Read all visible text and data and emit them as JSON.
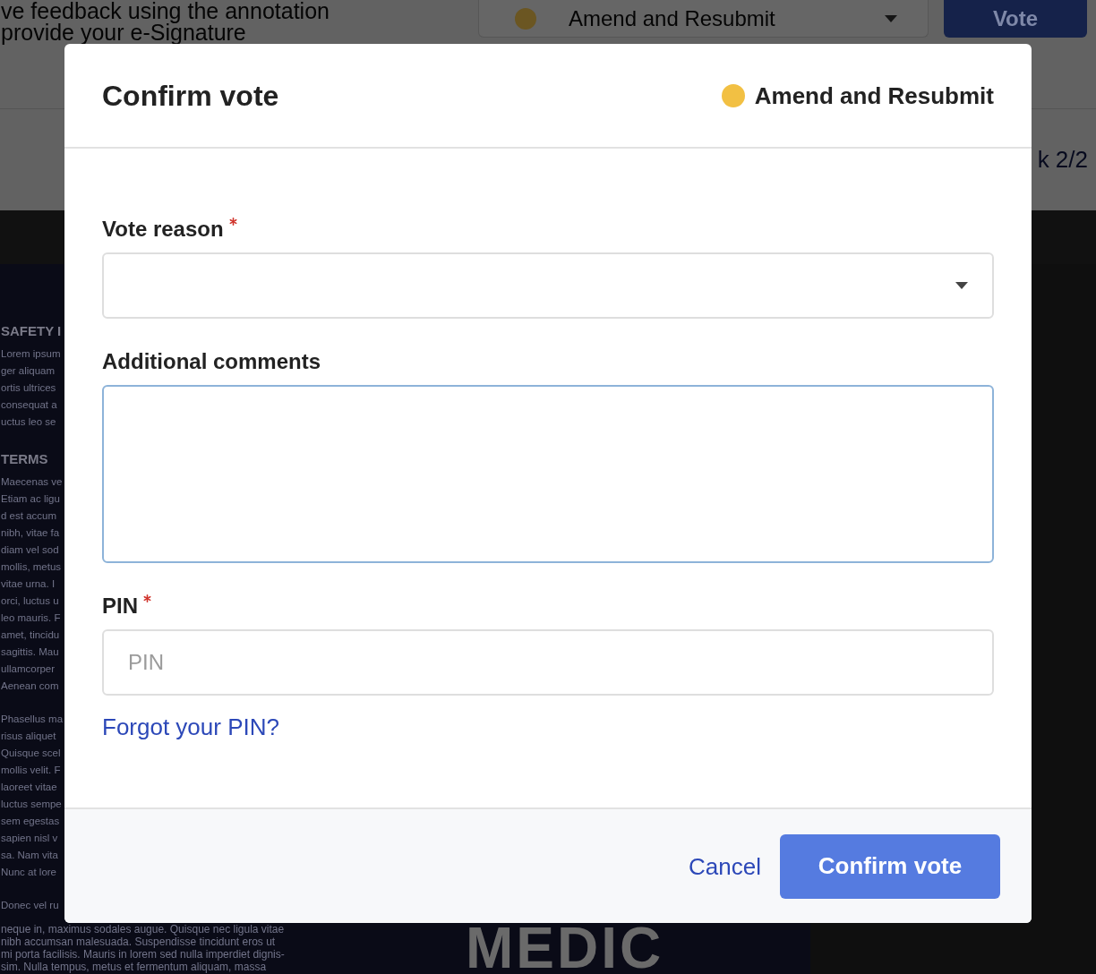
{
  "background": {
    "header": {
      "instructions": [
        "ve feedback using the annotation",
        "provide your e-Signature"
      ],
      "vote_select": {
        "value": "Amend and Resubmit"
      },
      "vote_button": "Vote"
    },
    "subheader": {
      "progress": "k 2/2"
    },
    "document": {
      "sections": [
        {
          "heading": "SAFETY I",
          "lines": [
            "Lorem ipsum",
            "ger aliquam",
            "ortis ultrices",
            "consequat a",
            "uctus leo se"
          ]
        },
        {
          "heading": "TERMS",
          "lines": [
            "Maecenas ve",
            "Etiam ac ligu",
            "d est accum",
            "nibh, vitae fa",
            "diam vel sod",
            "mollis, metus",
            "vitae urna. I",
            "orci, luctus u",
            "leo mauris. F",
            "amet, tincidu",
            "sagittis. Mau",
            "ullamcorper",
            "Aenean com"
          ]
        },
        {
          "lines": [
            "Phasellus ma",
            "risus aliquet",
            "Quisque scel",
            "mollis velit. F",
            "laoreet vitae",
            "luctus sempe",
            "sem egestas",
            "sapien nisl v",
            "sa. Nam vita",
            "Nunc at lore"
          ]
        },
        {
          "lines": [
            "Donec vel ru"
          ]
        }
      ],
      "bottom_lines": [
        "neque in, maximus sodales augue. Quisque nec ligula vitae",
        "nibh accumsan malesuada. Suspendisse tincidunt eros ut",
        "mi porta facilisis. Mauris in lorem sed nulla imperdiet dignis-",
        "sim. Nulla tempus, metus et fermentum aliquam, massa"
      ],
      "logo": "MEDIC"
    }
  },
  "dialog": {
    "title": "Confirm vote",
    "decision": {
      "label": "Amend and Resubmit",
      "color": "#f2c043"
    },
    "fields": [
      {
        "kind": "select",
        "label": "Vote reason",
        "required": true,
        "focused": false
      },
      {
        "kind": "textarea",
        "label": "Additional comments",
        "required": false,
        "focused": true
      },
      {
        "kind": "input",
        "label": "PIN",
        "required": true,
        "focused": false,
        "placeholder": "PIN"
      }
    ],
    "forgot_pin_link": "Forgot your PIN?",
    "cancel_button": "Cancel",
    "confirm_button": "Confirm vote"
  }
}
